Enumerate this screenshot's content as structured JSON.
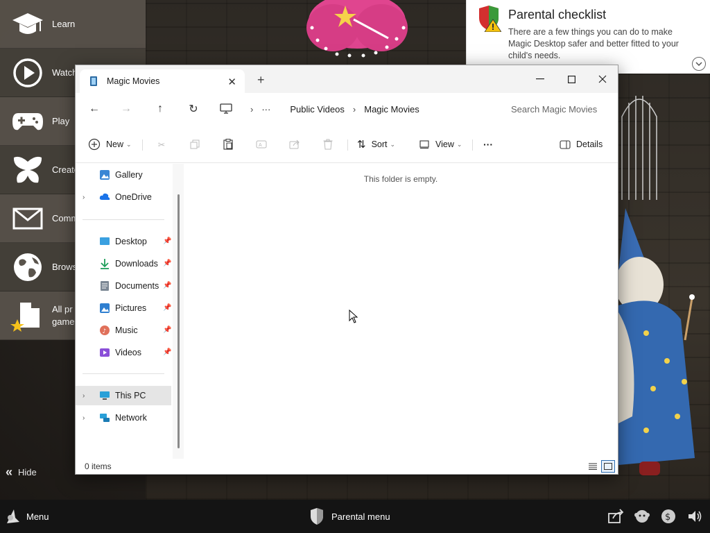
{
  "launcher": {
    "items": [
      {
        "label": "Learn",
        "icon": "graduation-cap-icon"
      },
      {
        "label": "Watch",
        "icon": "play-icon"
      },
      {
        "label": "Play",
        "icon": "gamepad-icon"
      },
      {
        "label": "Create",
        "icon": "butterfly-icon"
      },
      {
        "label": "Comm",
        "icon": "envelope-icon"
      },
      {
        "label": "Brows",
        "icon": "globe-icon"
      },
      {
        "label": "All pr",
        "label2": "game",
        "icon": "all-programs-icon"
      }
    ],
    "hide_label": "Hide"
  },
  "checklist": {
    "title": "Parental checklist",
    "body": "There are a few things you can do to make Magic Desktop safer and better fitted to your child's needs."
  },
  "window": {
    "tab_title": "Magic Movies",
    "breadcrumb": [
      "Public Videos",
      "Magic Movies"
    ],
    "breadcrumb_more": "···",
    "search_placeholder": "Search Magic Movies",
    "commands": {
      "new": "New",
      "sort": "Sort",
      "view": "View",
      "more": "···",
      "details": "Details"
    },
    "nav": {
      "gallery": "Gallery",
      "onedrive": "OneDrive",
      "quick_access": [
        {
          "label": "Desktop",
          "icon": "desktop-folder-icon"
        },
        {
          "label": "Downloads",
          "icon": "downloads-icon"
        },
        {
          "label": "Documents",
          "icon": "documents-icon"
        },
        {
          "label": "Pictures",
          "icon": "pictures-icon"
        },
        {
          "label": "Music",
          "icon": "music-icon"
        },
        {
          "label": "Videos",
          "icon": "videos-icon"
        }
      ],
      "this_pc": "This PC",
      "network": "Network"
    },
    "empty_message": "This folder is empty.",
    "status_count": "0 items"
  },
  "taskbar": {
    "menu_label": "Menu",
    "parental_label": "Parental menu"
  },
  "colors": {
    "accent": "#2b6cb0",
    "launcher_bg": "#5a544c",
    "taskbar_bg": "#141414"
  }
}
